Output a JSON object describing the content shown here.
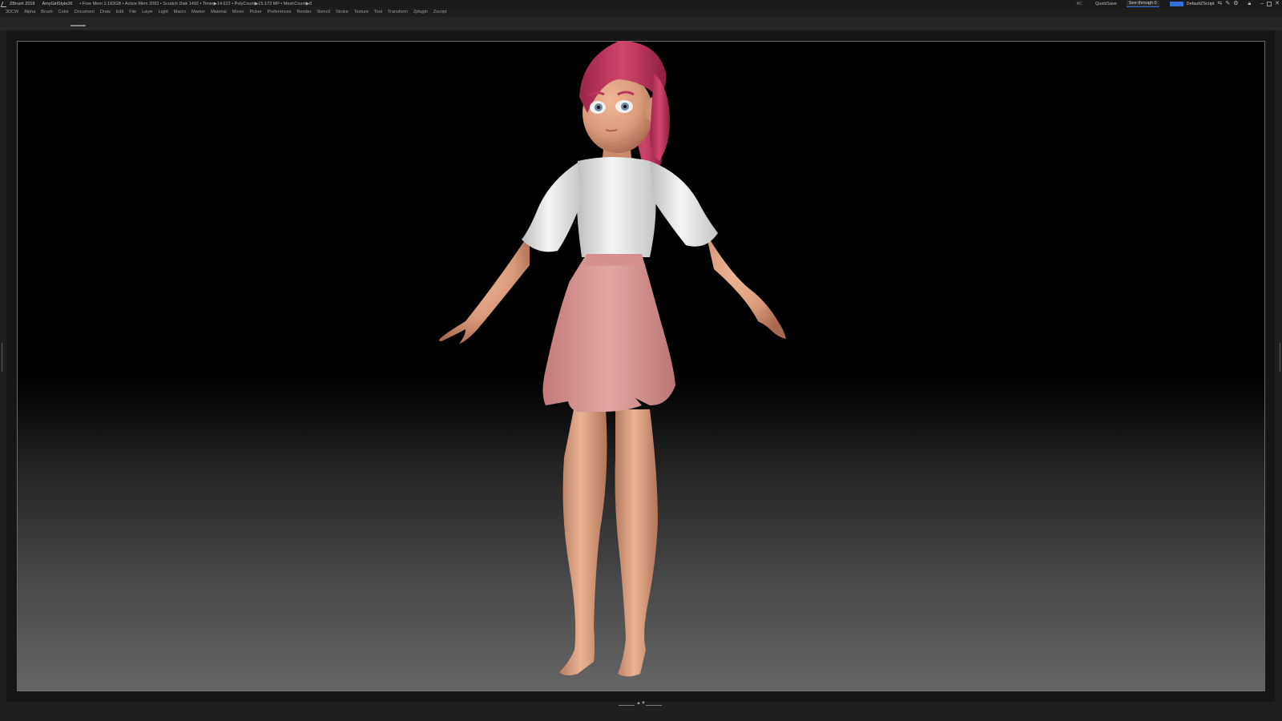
{
  "titlebar": {
    "app_title": "ZBrush 2019",
    "document": "AmyGirlStyle26",
    "stats": "• Free Mem 1.183GB • Active Mem 2083 • Scratch Disk 1492 • Timer▶14.622 • PolyCount▶15.173 MP • MeshCount▶8",
    "ac": "AC",
    "quicksave": "QuickSave",
    "see_through": "See-through  0",
    "menus_btn": "Menus",
    "script": "DefaultZScript"
  },
  "menubar": {
    "items": [
      "3DCW",
      "Alpha",
      "Brush",
      "Color",
      "Document",
      "Draw",
      "Edit",
      "File",
      "Layer",
      "Light",
      "Macro",
      "Marker",
      "Material",
      "Movie",
      "Picker",
      "Preferences",
      "Render",
      "Stencil",
      "Stroke",
      "Texture",
      "Tool",
      "Transform",
      "Zplugin",
      "Zscript"
    ]
  },
  "viewport": {
    "subject": "stylized female character",
    "colors": {
      "hair": "#b9375d",
      "skin": "#d99a7a",
      "shirt": "#eeeeee",
      "skirt": "#d6908e",
      "background_top": "#000000",
      "background_bottom": "#666666"
    }
  },
  "icons": [
    "zbrush-logo-icon",
    "layout-icon",
    "brush-icon",
    "palette-icon",
    "lock-icon",
    "minimize-icon",
    "restore-icon",
    "close-icon"
  ]
}
